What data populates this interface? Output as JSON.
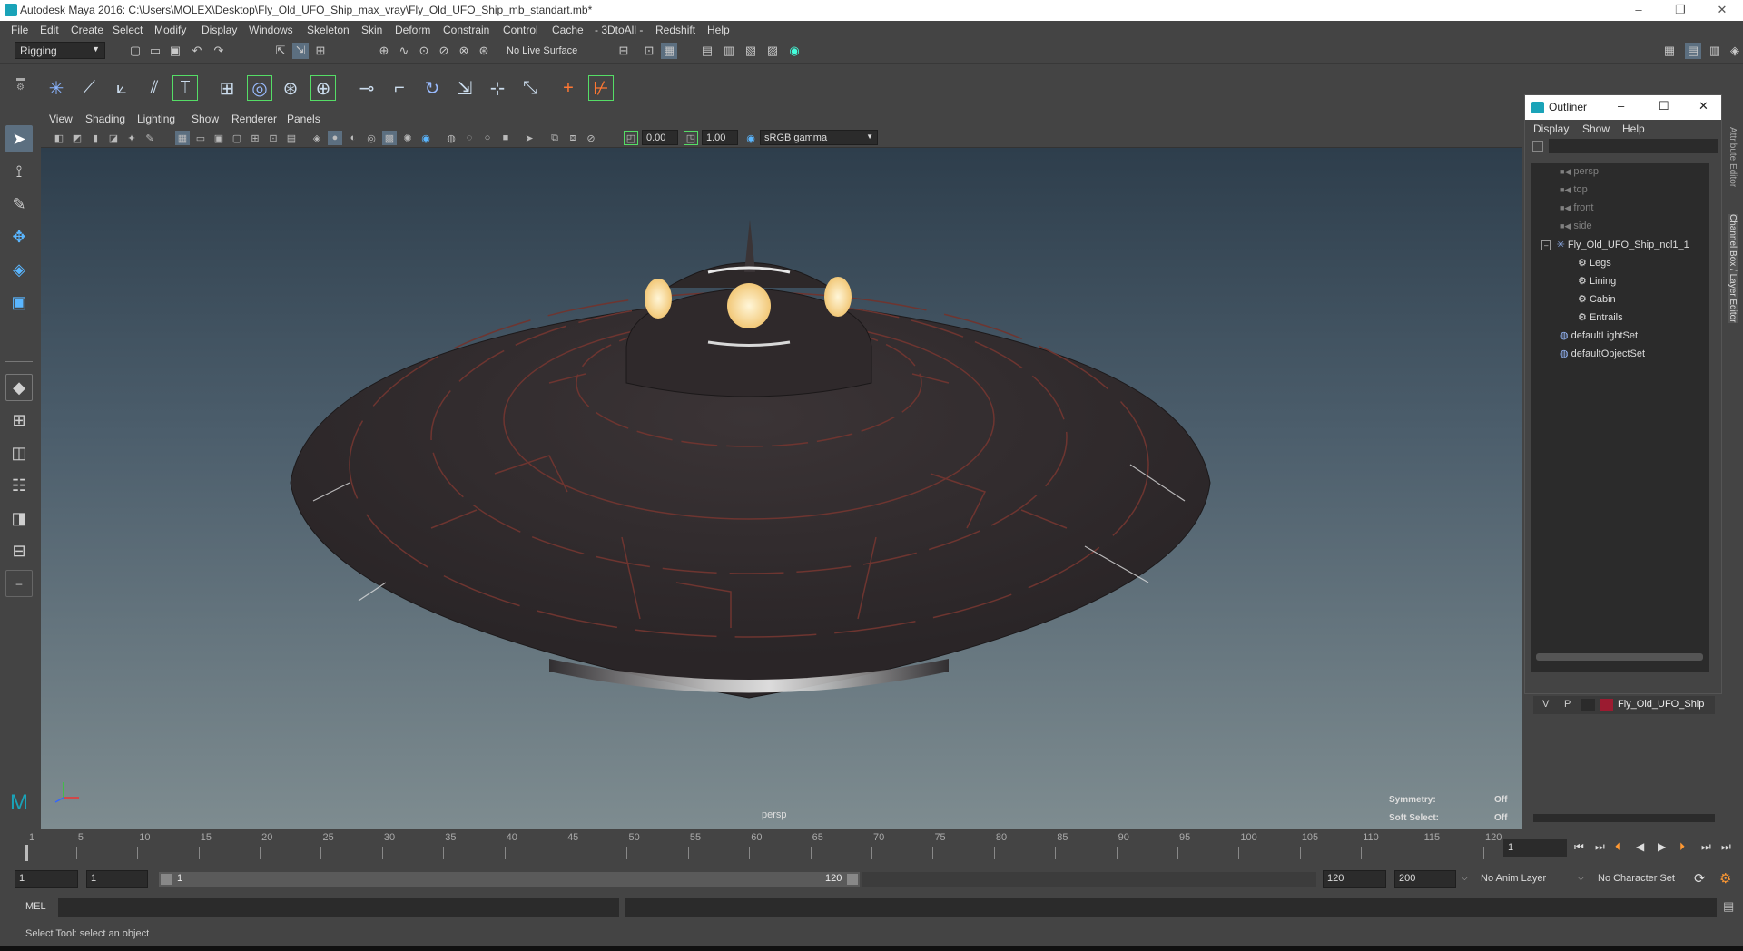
{
  "window": {
    "title": "Autodesk Maya 2016: C:\\Users\\MOLEX\\Desktop\\Fly_Old_UFO_Ship_max_vray\\Fly_Old_UFO_Ship_mb_standart.mb*",
    "minimize": "–",
    "restore": "❐",
    "close": "✕"
  },
  "menubar": [
    "File",
    "Edit",
    "Create",
    "Select",
    "Modify",
    "Display",
    "Windows",
    "Skeleton",
    "Skin",
    "Deform",
    "Constrain",
    "Control",
    "Cache",
    "- 3DtoAll -",
    "Redshift",
    "Help"
  ],
  "statusline": {
    "menuset": "Rigging",
    "live_surface": "No Live Surface"
  },
  "viewport": {
    "menu": [
      "View",
      "Shading",
      "Lighting",
      "Show",
      "Renderer",
      "Panels"
    ],
    "exposure": "0.00",
    "gamma": "1.00",
    "colorspace": "sRGB gamma",
    "camera_label": "persp",
    "symmetry_label": "Symmetry:",
    "symmetry_value": "Off",
    "softselect_label": "Soft Select:",
    "softselect_value": "Off"
  },
  "outliner": {
    "title": "Outliner",
    "menu": [
      "Display",
      "Show",
      "Help"
    ],
    "items": [
      {
        "label": "persp",
        "dim": true
      },
      {
        "label": "top",
        "dim": true
      },
      {
        "label": "front",
        "dim": true
      },
      {
        "label": "side",
        "dim": true
      },
      {
        "label": "Fly_Old_UFO_Ship_ncl1_1",
        "dim": false
      },
      {
        "label": "Legs",
        "dim": false
      },
      {
        "label": "Lining",
        "dim": false
      },
      {
        "label": "Cabin",
        "dim": false
      },
      {
        "label": "Entrails",
        "dim": false
      },
      {
        "label": "defaultLightSet",
        "dim": false
      },
      {
        "label": "defaultObjectSet",
        "dim": false
      }
    ]
  },
  "layer": {
    "v": "V",
    "p": "P",
    "name": "Fly_Old_UFO_Ship",
    "color": "#9b1b30"
  },
  "side_tabs": {
    "attribute_editor": "Attribute Editor",
    "channel_box": "Channel Box / Layer Editor"
  },
  "timeline": {
    "ticks": [
      "1",
      "5",
      "10",
      "15",
      "20",
      "25",
      "30",
      "35",
      "40",
      "45",
      "50",
      "55",
      "60",
      "65",
      "70",
      "75",
      "80",
      "85",
      "90",
      "95",
      "100",
      "105",
      "110",
      "115",
      "120"
    ],
    "current_frame": "1"
  },
  "range": {
    "start": "1",
    "playback_start": "1",
    "slider_start": "1",
    "slider_end": "120",
    "playback_end": "120",
    "end": "200",
    "anim_layer": "No Anim Layer",
    "character_set": "No Character Set"
  },
  "cmdline": {
    "label": "MEL"
  },
  "helpline": {
    "text": "Select Tool: select an object"
  },
  "colors": {
    "accent": "#5ab6ff",
    "ufo_glow": "#ffe3a8",
    "ufo_line": "#7a3a34"
  }
}
